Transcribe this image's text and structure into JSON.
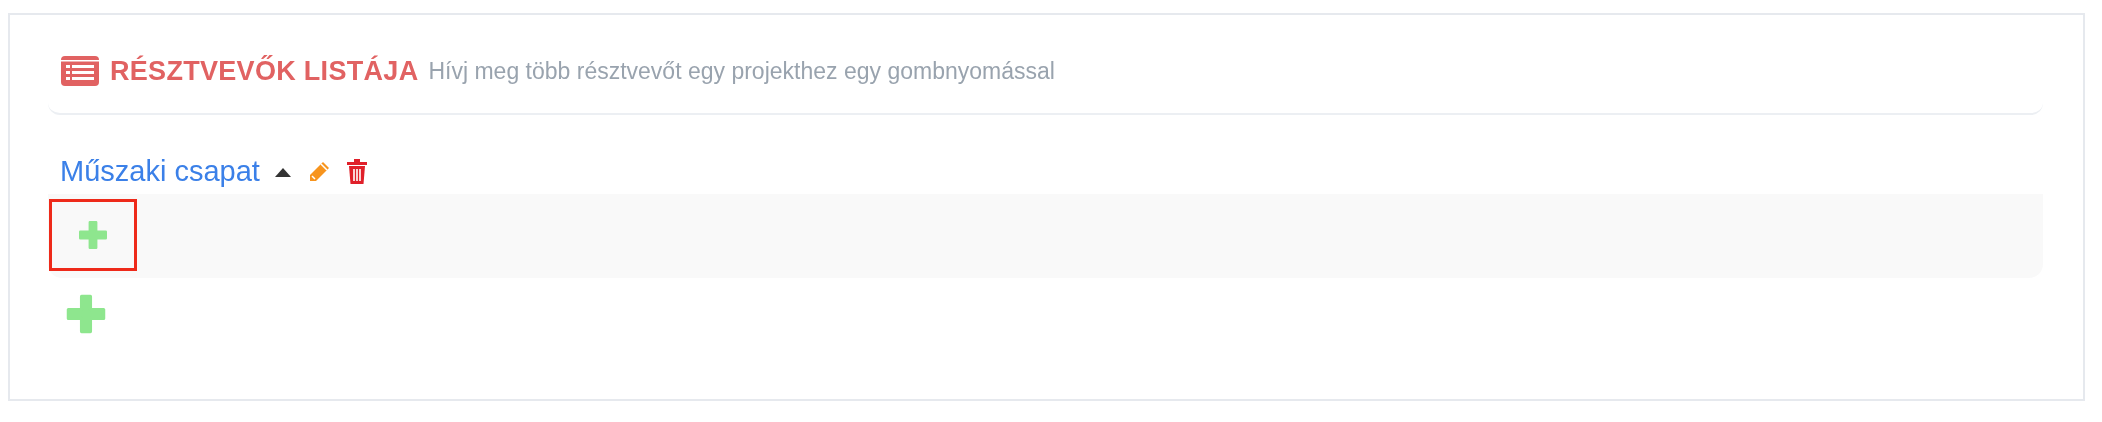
{
  "header": {
    "title": "RÉSZTVEVŐK LISTÁJA",
    "subtitle": "Hívj meg több résztvevőt egy projekthez egy gombnyomással"
  },
  "groups": [
    {
      "name": "Műszaki csapat",
      "expanded": true,
      "add_focused": true
    }
  ]
}
